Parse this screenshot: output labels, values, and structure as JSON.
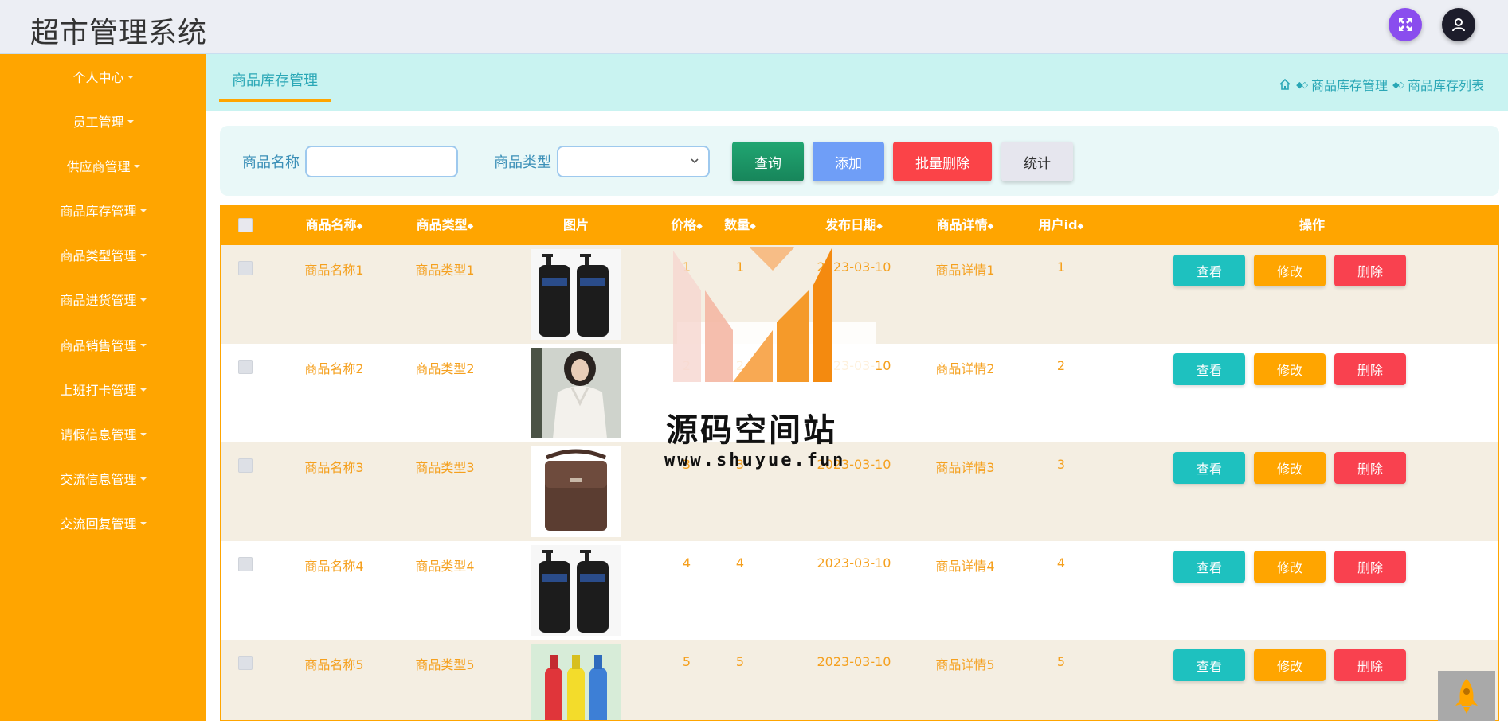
{
  "app": {
    "title": "超市管理系统"
  },
  "header_icons": {
    "fullscreen": "fullscreen-icon",
    "user": "user-icon"
  },
  "sidebar": {
    "items": [
      {
        "label": "个人中心"
      },
      {
        "label": "员工管理"
      },
      {
        "label": "供应商管理"
      },
      {
        "label": "商品库存管理"
      },
      {
        "label": "商品类型管理"
      },
      {
        "label": "商品进货管理"
      },
      {
        "label": "商品销售管理"
      },
      {
        "label": "上班打卡管理"
      },
      {
        "label": "请假信息管理"
      },
      {
        "label": "交流信息管理"
      },
      {
        "label": "交流回复管理"
      }
    ]
  },
  "tab": {
    "active_label": "商品库存管理"
  },
  "breadcrumb": {
    "items": [
      "商品库存管理",
      "商品库存列表"
    ]
  },
  "search": {
    "name_label": "商品名称",
    "name_value": "",
    "type_label": "商品类型",
    "type_value": "",
    "query_label": "查询",
    "add_label": "添加",
    "batch_delete_label": "批量删除",
    "stats_label": "统计"
  },
  "table": {
    "headers": {
      "name": "商品名称",
      "type": "商品类型",
      "image": "图片",
      "price": "价格",
      "quantity": "数量",
      "date": "发布日期",
      "detail": "商品详情",
      "user_id": "用户id",
      "actions": "操作"
    },
    "sort_glyph": "◆",
    "rows": [
      {
        "name": "商品名称1",
        "type": "商品类型1",
        "image": "men-facial-cleanser",
        "price": "1",
        "quantity": "1",
        "date": "2023-03-10",
        "detail": "商品详情1",
        "user_id": "1"
      },
      {
        "name": "商品名称2",
        "type": "商品类型2",
        "image": "white-blouse",
        "price": "2",
        "quantity": "2",
        "date": "2023-03-10",
        "detail": "商品详情2",
        "user_id": "2"
      },
      {
        "name": "商品名称3",
        "type": "商品类型3",
        "image": "leather-shoulder-bag",
        "price": "3",
        "quantity": "3",
        "date": "2023-03-10",
        "detail": "商品详情3",
        "user_id": "3"
      },
      {
        "name": "商品名称4",
        "type": "商品类型4",
        "image": "men-facial-cleanser",
        "price": "4",
        "quantity": "4",
        "date": "2023-03-10",
        "detail": "商品详情4",
        "user_id": "4"
      },
      {
        "name": "商品名称5",
        "type": "商品类型5",
        "image": "drink-bottles",
        "price": "5",
        "quantity": "5",
        "date": "2023-03-10",
        "detail": "商品详情5",
        "user_id": "5"
      }
    ],
    "action_labels": {
      "view": "查看",
      "edit": "修改",
      "delete": "删除"
    }
  },
  "watermark": {
    "title": "源码空间站",
    "url": "www.shuyue.fun"
  },
  "colors": {
    "sidebar": "#ffa500",
    "header_bg": "#eceef4",
    "crumb_bg": "#c9f3f1",
    "accent_teal": "#2aa7b6",
    "view_btn": "#1ec1bf",
    "edit_btn": "#ffa500",
    "delete_btn": "#f9414f",
    "query_btn": "#21a672",
    "add_btn": "#6f9ef7",
    "batch_btn": "#fb4348",
    "text_orange": "#f5a01e"
  }
}
